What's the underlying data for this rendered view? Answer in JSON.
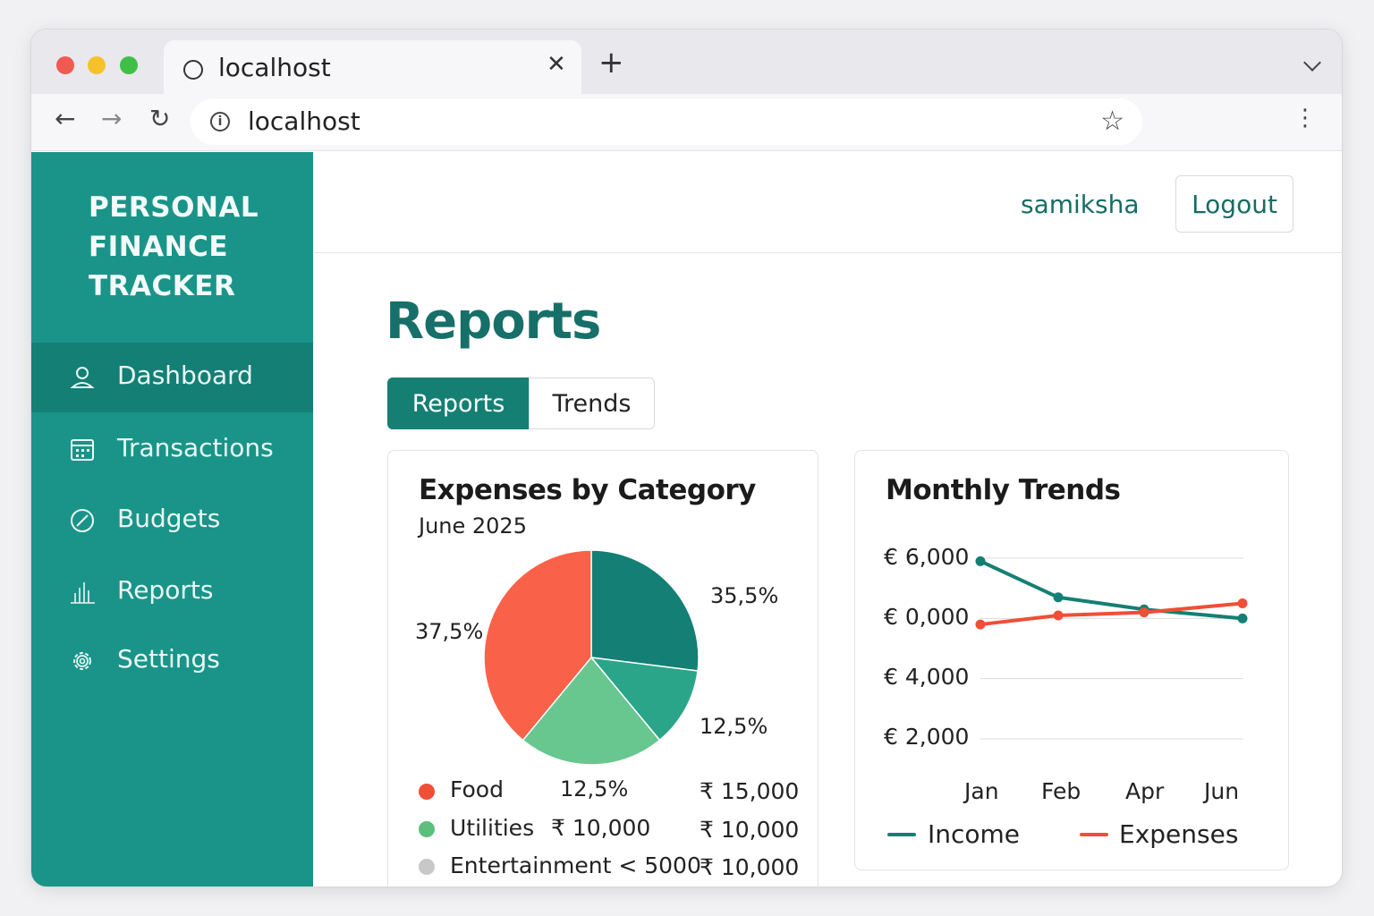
{
  "browser": {
    "tab_title": "localhost",
    "tab_close": "✕",
    "new_tab": "+",
    "url": "localhost",
    "back": "←",
    "forward": "→",
    "reload": "↻",
    "bookmark": "☆",
    "menu": "⋮",
    "info": "i"
  },
  "sidebar": {
    "brand": [
      "PERSONAL",
      "FINANCE",
      "TRACKER"
    ],
    "items": [
      {
        "label": "Dashboard",
        "icon": "user-icon",
        "active": true
      },
      {
        "label": "Transactions",
        "icon": "calendar-icon",
        "active": false
      },
      {
        "label": "Budgets",
        "icon": "budget-circle-icon",
        "active": false
      },
      {
        "label": "Reports",
        "icon": "bar-chart-icon",
        "active": false
      },
      {
        "label": "Settings",
        "icon": "gear-icon",
        "active": false
      }
    ]
  },
  "header": {
    "username": "samiksha",
    "logout_label": "Logout"
  },
  "page": {
    "title": "Reports",
    "tabs": [
      {
        "label": "Reports",
        "active": true
      },
      {
        "label": "Trends",
        "active": false
      }
    ]
  },
  "expenses_card": {
    "title": "Expenses by Category",
    "subtitle": "June 2025",
    "pct_labels": [
      "35,5%",
      "37,5%",
      "12,5%",
      "12,5%"
    ],
    "legend": [
      {
        "name": "Food",
        "color": "#f04e37",
        "value_text": "₹ 10,000",
        "amount": "₹ 15,000"
      },
      {
        "name": "Utilities",
        "color": "#5dbf7e",
        "value_text": "12,5%",
        "amount": "₹ 10,000"
      },
      {
        "name": "Entertainment < 5000",
        "color": "#c8c8c8",
        "amount": "₹ 10,000"
      }
    ]
  },
  "trends_card": {
    "title": "Monthly Trends",
    "legend": [
      {
        "name": "Income",
        "color": "#147f74"
      },
      {
        "name": "Expenses",
        "color": "#f04e37"
      }
    ]
  },
  "colors": {
    "sidebar": "#1a9488",
    "sidebar_active": "#147f75",
    "accent": "#176f69",
    "primary_button": "#167f74"
  },
  "chart_data": [
    {
      "type": "pie",
      "title": "Expenses by Category",
      "subtitle": "June 2025",
      "slices": [
        {
          "color": "#147f74",
          "percent_label": "35,5%",
          "value": 27
        },
        {
          "color": "#2ba58a",
          "percent_label": "12,5%",
          "value": 12
        },
        {
          "color": "#68c68f",
          "percent_label": "12,5%",
          "value": 22
        },
        {
          "color": "#fa6149",
          "percent_label": "37,5%",
          "value": 39
        }
      ],
      "legend": [
        "Food",
        "Utilities",
        "Entertainment < 5000"
      ]
    },
    {
      "type": "line",
      "title": "Monthly Trends",
      "categories": [
        "Jan",
        "Feb",
        "Apr",
        "Jun"
      ],
      "y_tick_labels": [
        "€ 6,000",
        "€ 0,000",
        "€ 4,000",
        "€ 2,000"
      ],
      "ylim": [
        2000,
        8000
      ],
      "grid": true,
      "legend_position": "bottom",
      "series": [
        {
          "name": "Income",
          "color": "#147f74",
          "values": [
            7900,
            6700,
            6300,
            6000
          ]
        },
        {
          "name": "Expenses",
          "color": "#f04e37",
          "values": [
            5800,
            6100,
            6200,
            6500
          ]
        }
      ]
    }
  ]
}
